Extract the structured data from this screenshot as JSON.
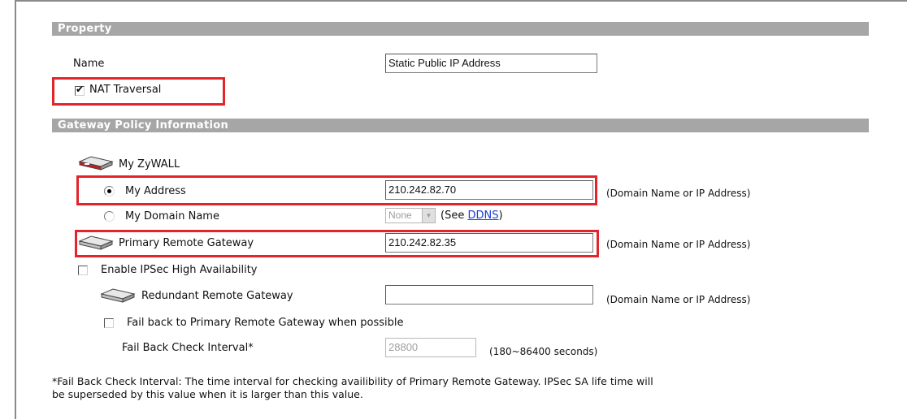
{
  "property": {
    "header": "Property",
    "name_label": "Name",
    "name_value": "Static Public IP Address",
    "nat_traversal_label": "NAT Traversal",
    "nat_traversal_checked": true
  },
  "gateway": {
    "header": "Gateway Policy Information",
    "my_zywall_label": "My ZyWALL",
    "my_address_label": "My Address",
    "my_address_value": "210.242.82.70",
    "my_address_hint": "(Domain Name or IP Address)",
    "my_domain_label": "My Domain Name",
    "my_domain_select": "None",
    "see_prefix": "(See ",
    "ddns_link": "DDNS",
    "see_suffix": ")",
    "primary_label": "Primary Remote Gateway",
    "primary_value": "210.242.82.35",
    "primary_hint": "(Domain Name or IP Address)",
    "enable_ha_label": "Enable IPSec High Availability",
    "redundant_label": "Redundant Remote Gateway",
    "redundant_value": "",
    "redundant_hint": "(Domain Name or IP Address)",
    "failback_label": "Fail back to Primary Remote Gateway when possible",
    "interval_label": "Fail Back Check Interval*",
    "interval_value": "28800",
    "interval_hint": "(180~86400 seconds)"
  },
  "footnote": {
    "line1": "*Fail Back Check Interval: The time interval for checking availibility of Primary Remote Gateway. IPSec SA life time will",
    "line2": "be superseded by this value when it is larger than this value."
  },
  "colors": {
    "section_bar": "#a6a6a6",
    "highlight": "#e3242b",
    "link": "#1a3fd6"
  }
}
